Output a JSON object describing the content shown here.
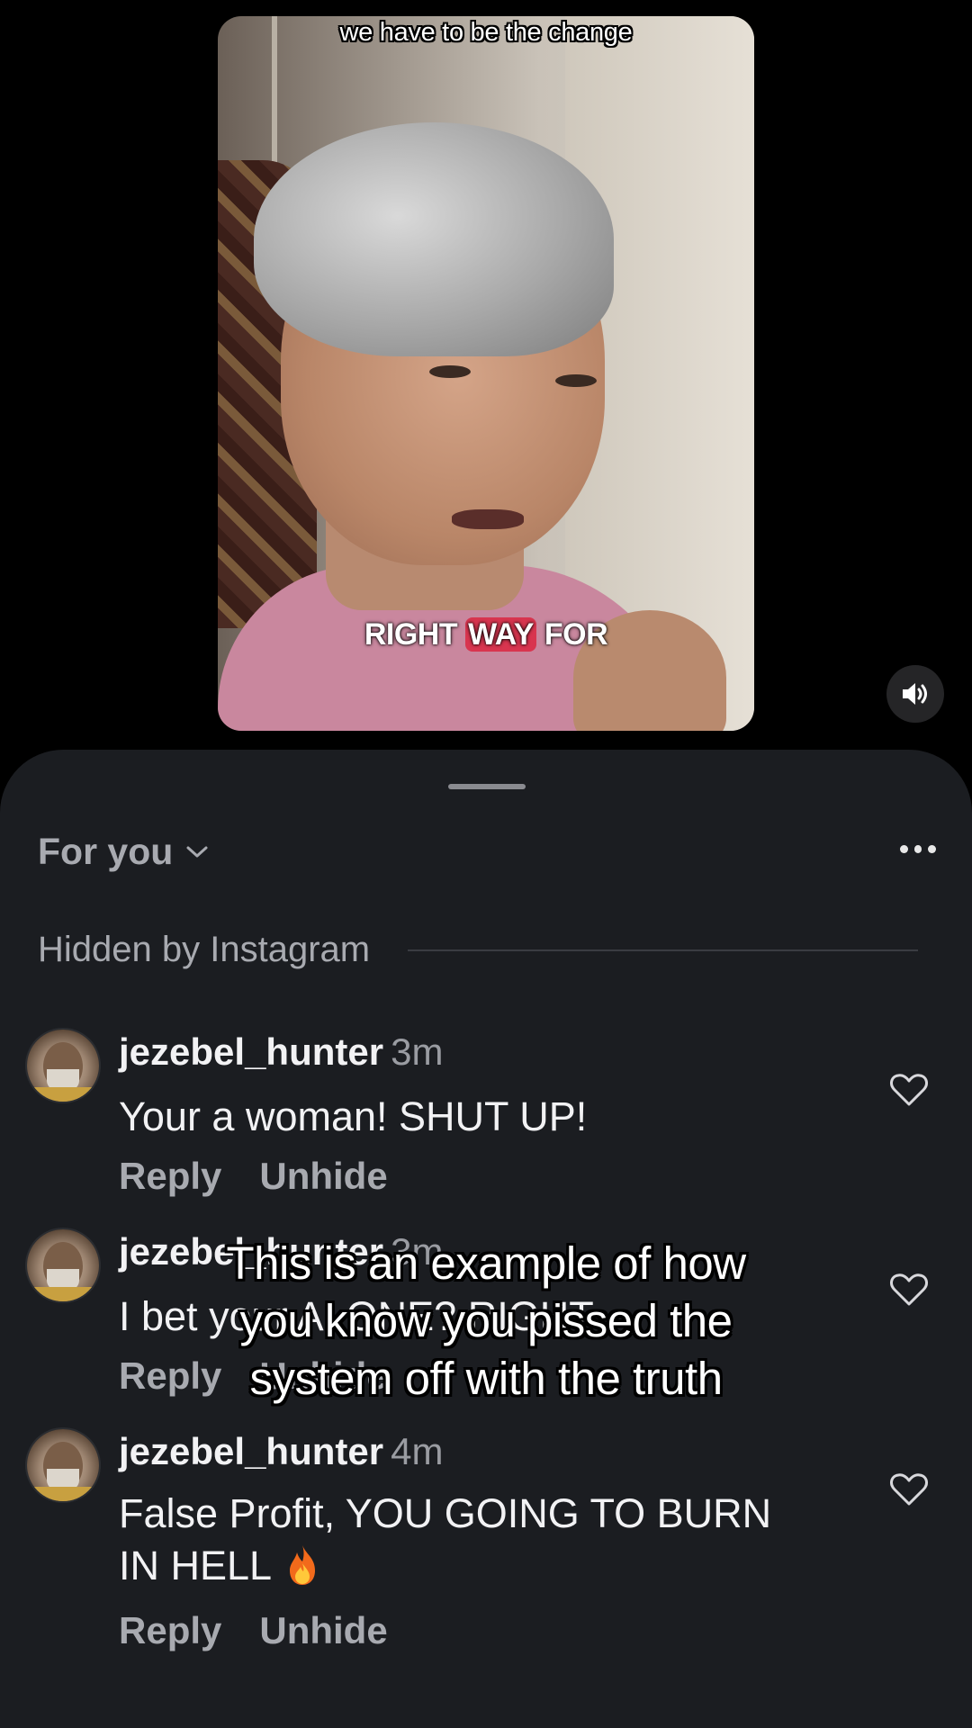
{
  "video": {
    "caption_top": "we have to be the change",
    "caption_bottom_pre": "RIGHT ",
    "caption_bottom_highlight": "WAY",
    "caption_bottom_post": " FOR",
    "highlight_color": "#d8354f",
    "sound_icon": "speaker-icon"
  },
  "comments_sheet": {
    "filter_label": "For you",
    "more_icon": "more-horizontal-icon",
    "section_label": "Hidden by Instagram",
    "comments": [
      {
        "username": "jezebel_hunter",
        "time": "3m",
        "text": "Your a woman! SHUT UP!",
        "reply_label": "Reply",
        "unhide_label": "Unhide"
      },
      {
        "username": "jezebel_hunter",
        "time": "3m",
        "text": "I bet your ALONE? RIGHT",
        "reply_label": "Reply",
        "unhide_label": "Unhide"
      },
      {
        "username": "jezebel_hunter",
        "time": "4m",
        "text": "False Profit, YOU GOING TO BURN IN HELL",
        "emoji": "fire-emoji",
        "reply_label": "Reply",
        "unhide_label": "Unhide"
      }
    ]
  },
  "overlay_caption": {
    "line1": "This is an example of how",
    "line2": "you know you pissed the",
    "line3": "system off with the truth"
  }
}
